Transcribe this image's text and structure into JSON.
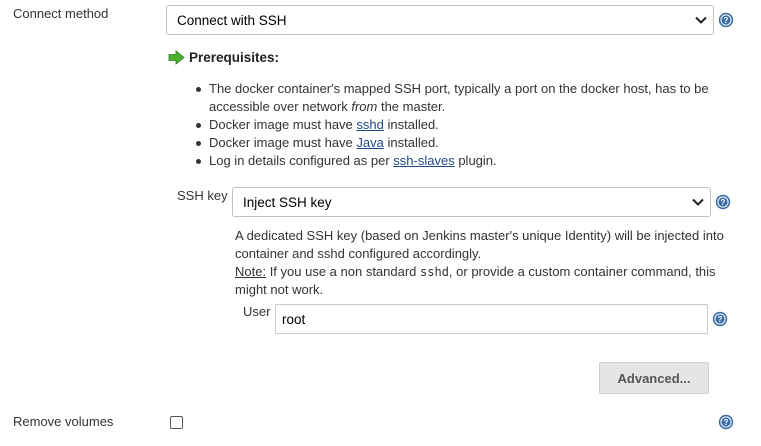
{
  "connect_method": {
    "label": "Connect method",
    "selected": "Connect with SSH"
  },
  "prerequisites": {
    "title": "Prerequisites:",
    "items": [
      {
        "text_before": "The docker container's mapped SSH port, typically a port on the docker host, has to be accessible over network ",
        "emphasis": "from",
        "text_after": " the master."
      },
      {
        "text_before": "Docker image must have ",
        "link": "sshd",
        "text_after": " installed."
      },
      {
        "text_before": "Docker image must have ",
        "link": "Java",
        "text_after": " installed."
      },
      {
        "text_before": "Log in details configured as per ",
        "link": "ssh-slaves",
        "text_after": " plugin."
      }
    ]
  },
  "ssh_key": {
    "label": "SSH key",
    "selected": "Inject SSH key",
    "description": "A dedicated SSH key (based on Jenkins master's unique Identity) will be injected into container and sshd configured accordingly.",
    "note_label": "Note:",
    "note_before": " If you use a non standard ",
    "note_code": "sshd",
    "note_after": ", or provide a custom container command, this might not work."
  },
  "user": {
    "label": "User",
    "value": "root"
  },
  "advanced_button": "Advanced...",
  "remove_volumes": {
    "label": "Remove volumes",
    "checked": false
  },
  "colors": {
    "help_icon": "#3a6ea5",
    "arrow_icon": "#4caf2e",
    "link": "#204a87"
  }
}
